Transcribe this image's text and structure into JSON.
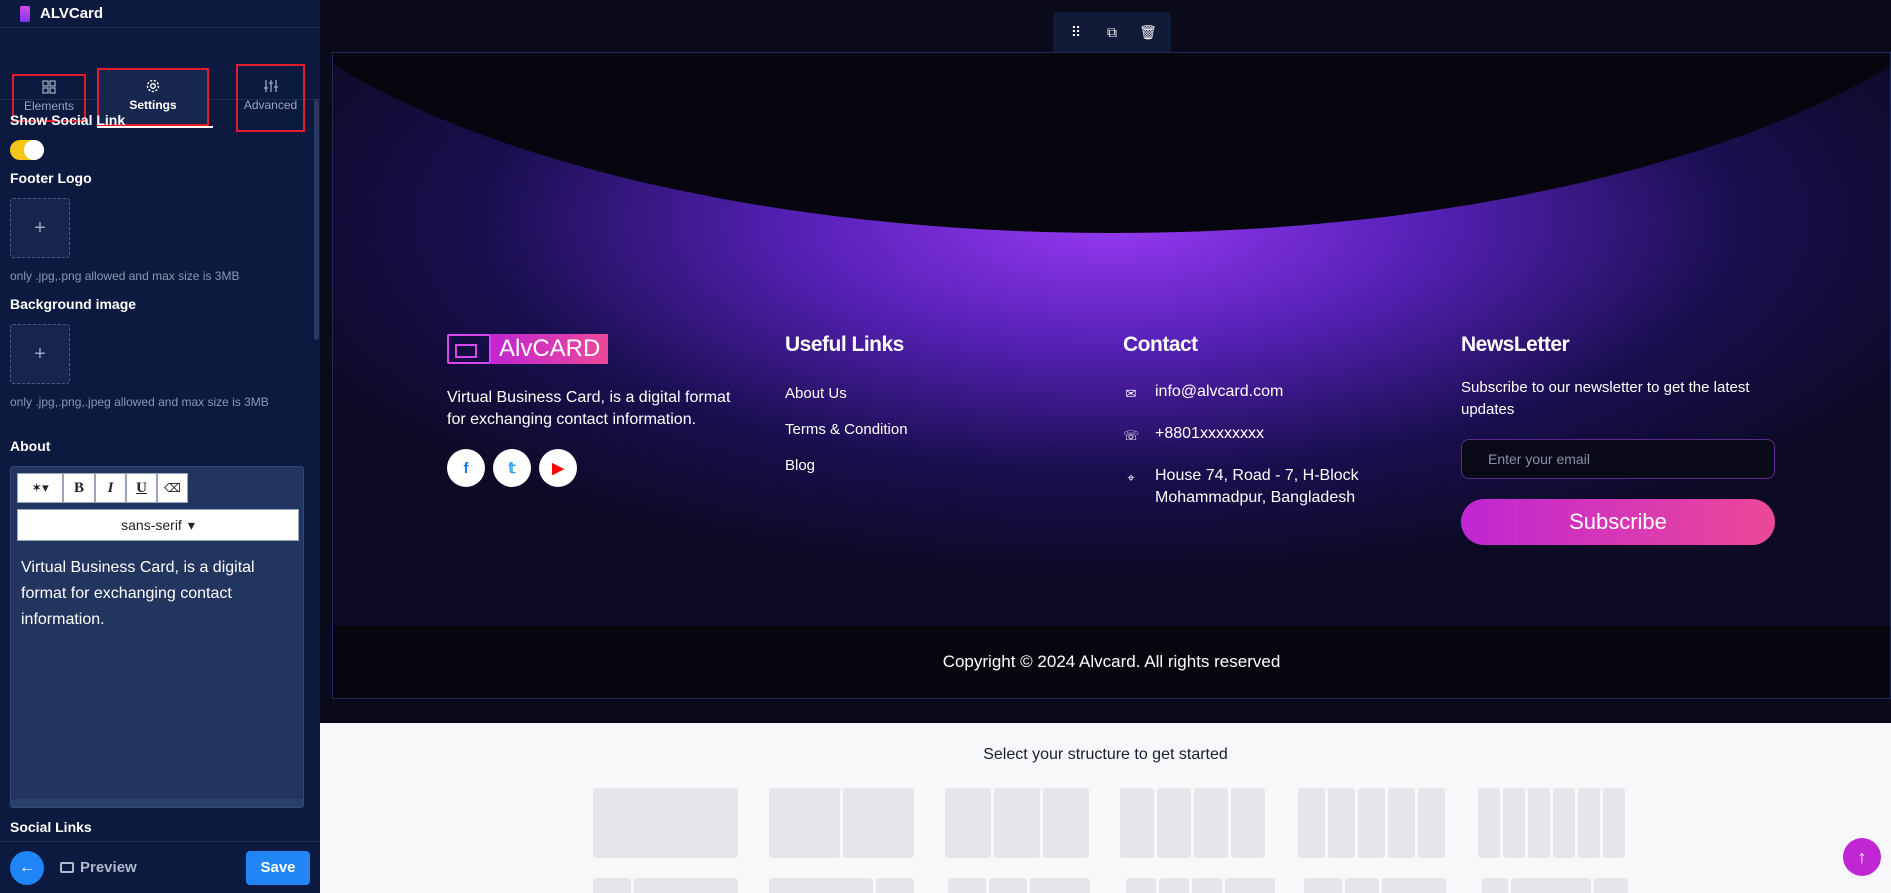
{
  "app": {
    "name": "ALVCard"
  },
  "sidebar": {
    "tabs": [
      {
        "label": "Elements"
      },
      {
        "label": "Settings"
      },
      {
        "label": "Advanced"
      }
    ],
    "show_social_link": {
      "label": "Show Social Link",
      "enabled": true
    },
    "footer_logo": {
      "label": "Footer Logo",
      "help": "only .jpg,.png allowed and max size is 3MB"
    },
    "background_image": {
      "label": "Background image",
      "help": "only .jpg,.png,.jpeg allowed and max size is 3MB"
    },
    "about": {
      "label": "About",
      "font": "sans-serif",
      "content": "Virtual Business Card, is a digital format for exchanging contact information."
    },
    "social_links": {
      "label": "Social Links"
    },
    "footer": {
      "preview": "Preview",
      "save": "Save"
    }
  },
  "canvas": {
    "footer": {
      "logo_text": "AlvCARD",
      "about": "Virtual Business Card, is a digital format for exchanging contact information.",
      "useful_links": {
        "title": "Useful Links",
        "items": [
          "About Us",
          "Terms & Condition",
          "Blog"
        ]
      },
      "contact": {
        "title": "Contact",
        "email": "info@alvcard.com",
        "phone": "+8801xxxxxxxx",
        "address_line1": "House 74, Road - 7, H-Block",
        "address_line2": "Mohammadpur, Bangladesh"
      },
      "newsletter": {
        "title": "NewsLetter",
        "text": "Subscribe to our newsletter to get the latest updates",
        "placeholder": "Enter your email",
        "button": "Subscribe"
      },
      "copyright": "Copyright © 2024 Alvcard. All rights reserved"
    },
    "structure": {
      "title": "Select your structure to get started"
    }
  },
  "colors": {
    "accent": "#2185f5",
    "brand_gradient_start": "#c026d3",
    "brand_gradient_end": "#ec4899",
    "toggle_on": "#f5c518"
  },
  "icons": [
    "grid-icon",
    "gear-icon",
    "sliders-icon",
    "drag-handle-icon",
    "duplicate-icon",
    "trash-icon",
    "facebook-icon",
    "twitter-icon",
    "youtube-icon",
    "mail-icon",
    "phone-icon",
    "location-icon",
    "arrow-up-icon",
    "arrow-left-icon",
    "monitor-icon"
  ]
}
